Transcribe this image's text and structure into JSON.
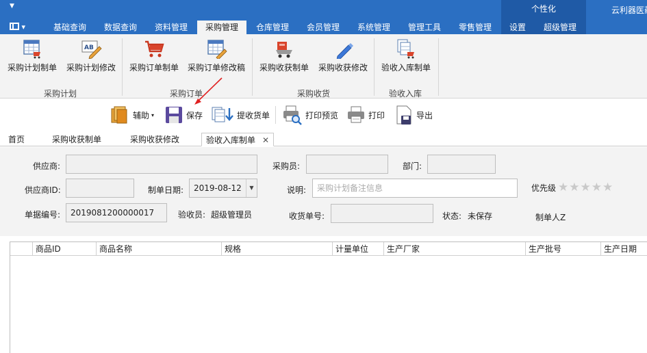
{
  "titlebar": {
    "personalize": "个性化",
    "app_title": "云利器医药"
  },
  "tabs": [
    {
      "label": "基础查询"
    },
    {
      "label": "数据查询"
    },
    {
      "label": "资料管理"
    },
    {
      "label": "采购管理"
    },
    {
      "label": "仓库管理"
    },
    {
      "label": "会员管理"
    },
    {
      "label": "系统管理"
    },
    {
      "label": "管理工具"
    },
    {
      "label": "零售管理"
    },
    {
      "label": "设置"
    },
    {
      "label": "超级管理"
    }
  ],
  "ribbon": {
    "buttons": [
      {
        "label": "采购计划制单",
        "icon": "purchase-plan-icon"
      },
      {
        "label": "采购计划修改",
        "icon": "edit-plan-icon"
      },
      {
        "label": "采购订单制单",
        "icon": "cart-icon"
      },
      {
        "label": "采购订单修改稿",
        "icon": "edit-order-icon"
      },
      {
        "label": "采购收获制单",
        "icon": "receive-icon"
      },
      {
        "label": "采购收获修改",
        "icon": "pencil-icon"
      },
      {
        "label": "验收入库制单",
        "icon": "stock-in-icon"
      }
    ],
    "groups": [
      {
        "label": "采购计划"
      },
      {
        "label": "采购订单"
      },
      {
        "label": "采购收货"
      },
      {
        "label": "验收入库"
      }
    ]
  },
  "toolbar": {
    "assist": "辅助",
    "save": "保存",
    "pick_receipt": "提收货单",
    "print_preview": "打印预览",
    "print": "打印",
    "export": "导出"
  },
  "doc_tabs": [
    {
      "label": "首页"
    },
    {
      "label": "采购收获制单"
    },
    {
      "label": "采购收获修改"
    },
    {
      "label": "验收入库制单"
    }
  ],
  "form": {
    "supplier_label": "供应商:",
    "buyer_label": "采购员:",
    "dept_label": "部门:",
    "supplier_id_label": "供应商ID:",
    "date_label": "制单日期:",
    "date_value": "2019-08-12",
    "remark_label": "说明:",
    "remark_placeholder": "采购计划备注信息",
    "priority_label": "优先级",
    "priority_stars": "★★★★★",
    "doc_no_label": "单据编号:",
    "doc_no_value": "2019081200000017",
    "inspector_label": "验收员:",
    "inspector_value": "超级管理员",
    "receipt_no_label": "收货单号:",
    "status_label": "状态:",
    "status_value": "未保存",
    "maker_label": "制单人Z"
  },
  "grid": {
    "columns": [
      "商品ID",
      "商品名称",
      "规格",
      "计量单位",
      "生产厂家",
      "生产批号",
      "生产日期"
    ]
  }
}
